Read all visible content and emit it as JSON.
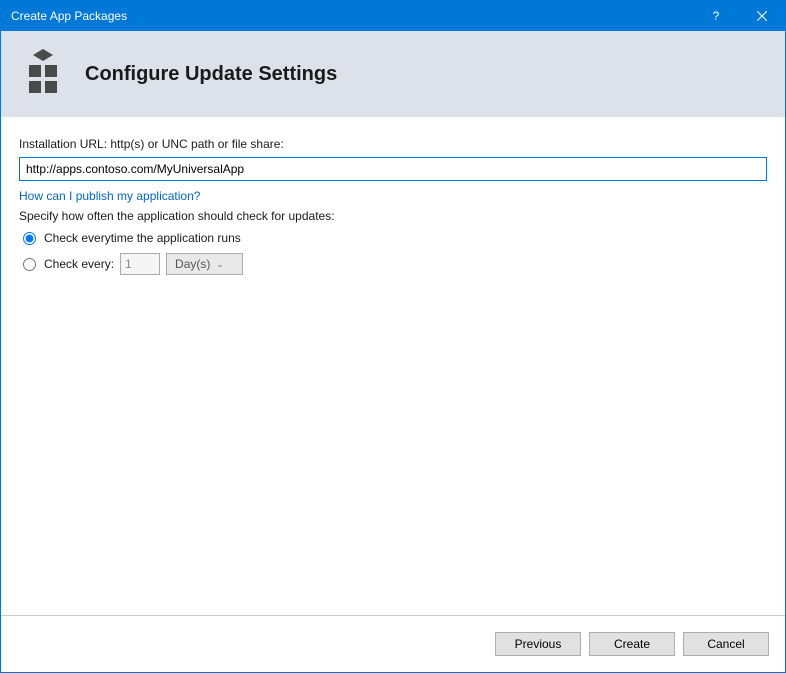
{
  "window": {
    "title": "Create App Packages"
  },
  "header": {
    "heading": "Configure Update Settings"
  },
  "form": {
    "url_label": "Installation URL: http(s) or UNC path or file share:",
    "url_value": "http://apps.contoso.com/MyUniversalApp",
    "publish_link": "How can I publish my application?",
    "spec_label": "Specify how often the application should check for updates:",
    "radio_everytime": "Check everytime the application runs",
    "radio_every": "Check every:",
    "interval_value": "1",
    "interval_unit": "Day(s)"
  },
  "footer": {
    "previous": "Previous",
    "create": "Create",
    "cancel": "Cancel"
  }
}
